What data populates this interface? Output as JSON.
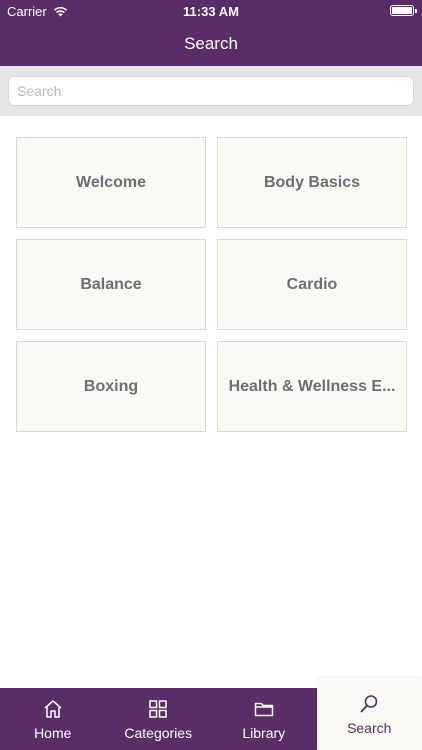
{
  "status_bar": {
    "carrier": "Carrier",
    "time": "11:33 AM"
  },
  "nav": {
    "title": "Search"
  },
  "search": {
    "placeholder": "Search",
    "value": ""
  },
  "categories": [
    {
      "label": "Welcome"
    },
    {
      "label": "Body Basics"
    },
    {
      "label": "Balance"
    },
    {
      "label": "Cardio"
    },
    {
      "label": "Boxing"
    },
    {
      "label": "Health & Wellness E..."
    }
  ],
  "tabs": [
    {
      "label": "Home",
      "icon": "home-icon"
    },
    {
      "label": "Categories",
      "icon": "grid-icon"
    },
    {
      "label": "Library",
      "icon": "folder-icon"
    },
    {
      "label": "Search",
      "icon": "search-icon",
      "active": true
    }
  ],
  "colors": {
    "brand": "#5a2d66",
    "tile_bg": "#faf9f3",
    "tile_text": "#6e6e74"
  }
}
